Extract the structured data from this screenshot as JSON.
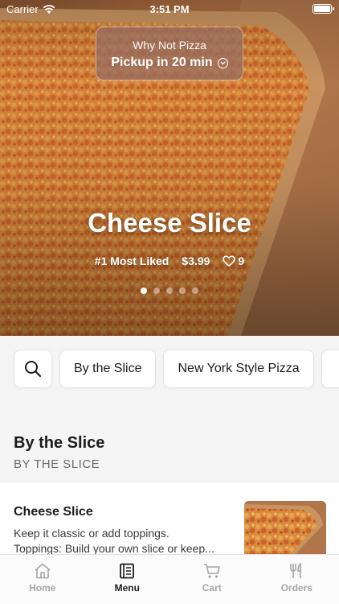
{
  "status_bar": {
    "carrier": "Carrier",
    "time": "3:51 PM"
  },
  "store": {
    "name": "Why Not Pizza",
    "pickup": "Pickup in 20 min"
  },
  "hero": {
    "title": "Cheese Slice",
    "rank": "#1 Most Liked",
    "price": "$3.99",
    "likes": "9",
    "carousel": {
      "count": 5,
      "active_index": 0
    }
  },
  "categories": {
    "search_icon": "search-icon",
    "items": [
      {
        "label": "By the Slice"
      },
      {
        "label": "New York Style Pizza"
      }
    ]
  },
  "section": {
    "title": "By the Slice",
    "subtitle": "BY THE SLICE"
  },
  "menu_items": [
    {
      "name": "Cheese Slice",
      "desc_line1": "Keep it classic or add toppings.",
      "desc_line2": "Toppings: Build your own slice or keep..."
    }
  ],
  "tabs": [
    {
      "label": "Home",
      "icon": "home-icon",
      "active": false
    },
    {
      "label": "Menu",
      "icon": "menu-icon",
      "active": true
    },
    {
      "label": "Cart",
      "icon": "cart-icon",
      "active": false
    },
    {
      "label": "Orders",
      "icon": "fork-knife-icon",
      "active": false
    }
  ],
  "colors": {
    "accent": "#1c1c1e",
    "inactive_tab": "#a5a5aa",
    "background": "#f5f5f6"
  }
}
